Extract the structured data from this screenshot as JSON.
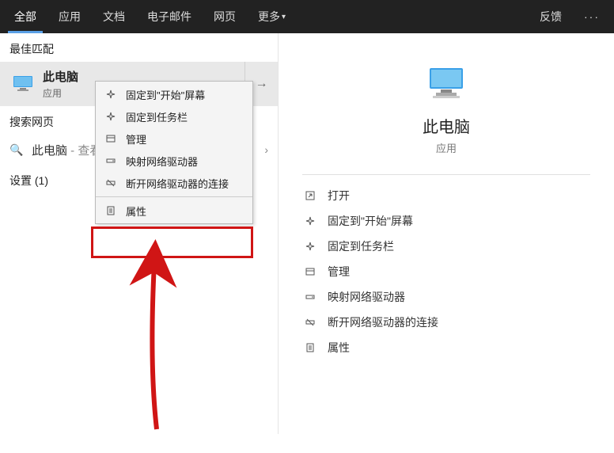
{
  "topbar": {
    "tabs": [
      {
        "label": "全部",
        "active": true
      },
      {
        "label": "应用",
        "active": false
      },
      {
        "label": "文档",
        "active": false
      },
      {
        "label": "电子邮件",
        "active": false
      },
      {
        "label": "网页",
        "active": false
      },
      {
        "label": "更多",
        "active": false,
        "dropdown": true
      }
    ],
    "feedback": "反馈",
    "more": "···"
  },
  "left": {
    "best_match_label": "最佳匹配",
    "best_match": {
      "title": "此电脑",
      "subtitle": "应用",
      "arrow": "→"
    },
    "search_web_label": "搜索网页",
    "search_row": {
      "query": "此电脑",
      "suffix": " - 查看网",
      "chevron": "›"
    },
    "settings_label": "设置 (1)"
  },
  "context_menu": {
    "items": [
      {
        "icon": "⬚",
        "icon_name": "pin-start-icon",
        "label": "固定到\"开始\"屏幕"
      },
      {
        "icon": "⬚",
        "icon_name": "pin-taskbar-icon",
        "label": "固定到任务栏"
      },
      {
        "icon": "🗀",
        "icon_name": "manage-icon",
        "label": "管理"
      },
      {
        "icon": "🖧",
        "icon_name": "map-drive-icon",
        "label": "映射网络驱动器"
      },
      {
        "icon": "🖧",
        "icon_name": "disconnect-drive-icon",
        "label": "断开网络驱动器的连接"
      },
      {
        "icon": "☰",
        "icon_name": "properties-icon",
        "label": "属性",
        "highlighted": true
      }
    ]
  },
  "right": {
    "hero": {
      "title": "此电脑",
      "subtitle": "应用"
    },
    "actions": [
      {
        "icon": "⧉",
        "icon_name": "open-icon",
        "label": "打开"
      },
      {
        "icon": "⬚",
        "icon_name": "pin-start-icon",
        "label": "固定到\"开始\"屏幕"
      },
      {
        "icon": "⬚",
        "icon_name": "pin-taskbar-icon",
        "label": "固定到任务栏"
      },
      {
        "icon": "🗀",
        "icon_name": "manage-icon",
        "label": "管理"
      },
      {
        "icon": "🖧",
        "icon_name": "map-drive-icon",
        "label": "映射网络驱动器"
      },
      {
        "icon": "🖧",
        "icon_name": "disconnect-drive-icon",
        "label": "断开网络驱动器的连接"
      },
      {
        "icon": "☰",
        "icon_name": "properties-icon",
        "label": "属性"
      }
    ]
  },
  "colors": {
    "highlight": "#d01515",
    "tab_underline": "#5aa0e6"
  }
}
